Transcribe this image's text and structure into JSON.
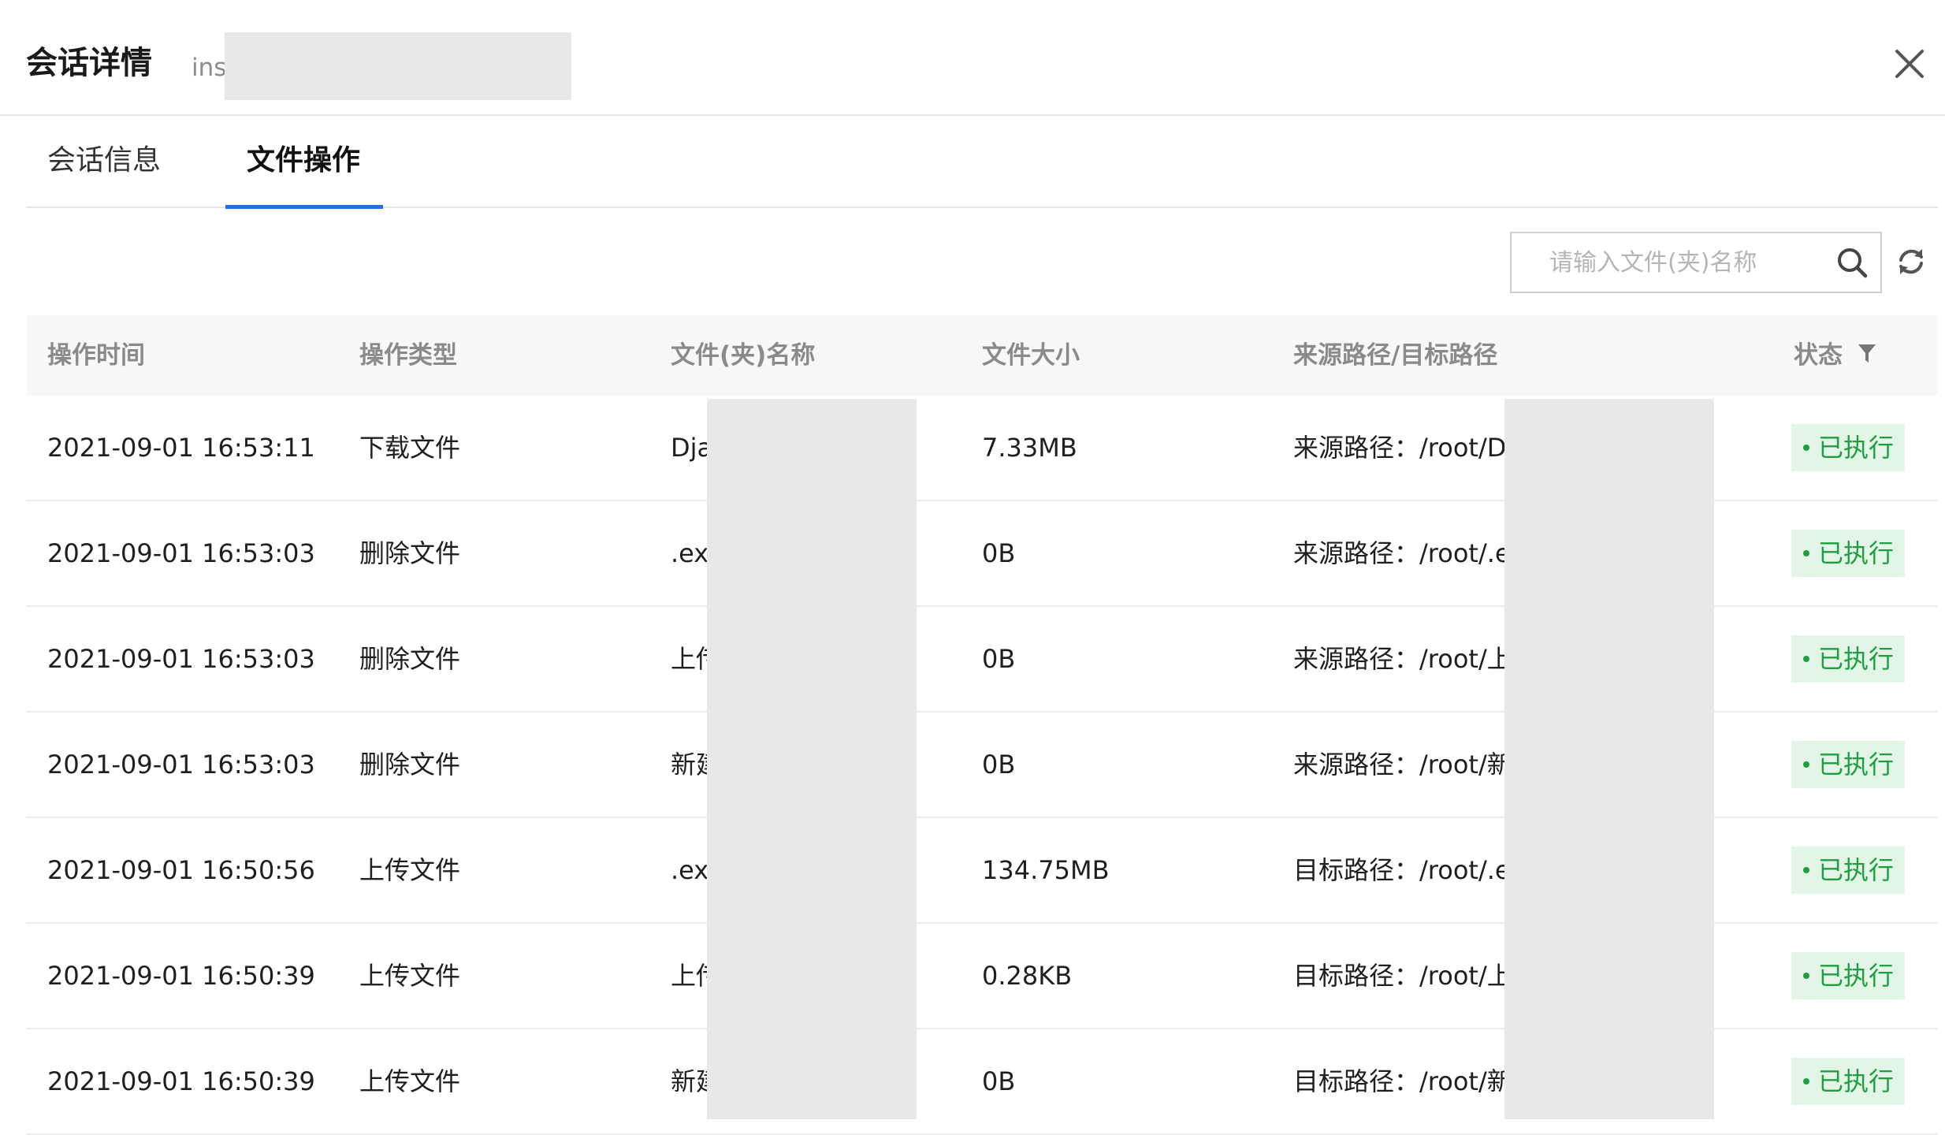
{
  "dialog": {
    "title": "会话详情",
    "instance_prefix": "ins",
    "close_icon": "close-icon"
  },
  "tabs": [
    {
      "label": "会话信息",
      "active": false
    },
    {
      "label": "文件操作",
      "active": true
    }
  ],
  "toolbar": {
    "search_placeholder": "请输入文件(夹)名称",
    "search_value": "",
    "search_icon": "search-icon",
    "refresh_icon": "refresh-icon"
  },
  "table": {
    "columns": [
      "操作时间",
      "操作类型",
      "文件(夹)名称",
      "文件大小",
      "来源路径/目标路径",
      "状态"
    ],
    "status_filter_icon": "filter-icon",
    "rows": [
      {
        "time": "2021-09-01 16:53:11",
        "type": "下载文件",
        "name": "Dja",
        "size": "7.33MB",
        "path": "来源路径：/root/Dj",
        "status": "已执行"
      },
      {
        "time": "2021-09-01 16:53:03",
        "type": "删除文件",
        "name": ".ex",
        "size": "0B",
        "path": "来源路径：/root/.ex",
        "status": "已执行"
      },
      {
        "time": "2021-09-01 16:53:03",
        "type": "删除文件",
        "name": "上传",
        "size": "0B",
        "path": "来源路径：/root/上",
        "status": "已执行"
      },
      {
        "time": "2021-09-01 16:53:03",
        "type": "删除文件",
        "name": "新建",
        "size": "0B",
        "path": "来源路径：/root/新",
        "status": "已执行"
      },
      {
        "time": "2021-09-01 16:50:56",
        "type": "上传文件",
        "name": ".ex",
        "size": "134.75MB",
        "path": "目标路径：/root/.ex",
        "status": "已执行"
      },
      {
        "time": "2021-09-01 16:50:39",
        "type": "上传文件",
        "name": "上传",
        "size": "0.28KB",
        "path": "目标路径：/root/上",
        "status": "已执行"
      },
      {
        "time": "2021-09-01 16:50:39",
        "type": "上传文件",
        "name": "新建",
        "size": "0B",
        "path": "目标路径：/root/新",
        "status": "已执行"
      }
    ]
  },
  "colors": {
    "accent": "#1f6fe5",
    "status_text": "#1f9e41",
    "status_bg": "#e3f5e6",
    "header_bg": "#f7f8fa",
    "redaction": "#e8e8e8"
  }
}
